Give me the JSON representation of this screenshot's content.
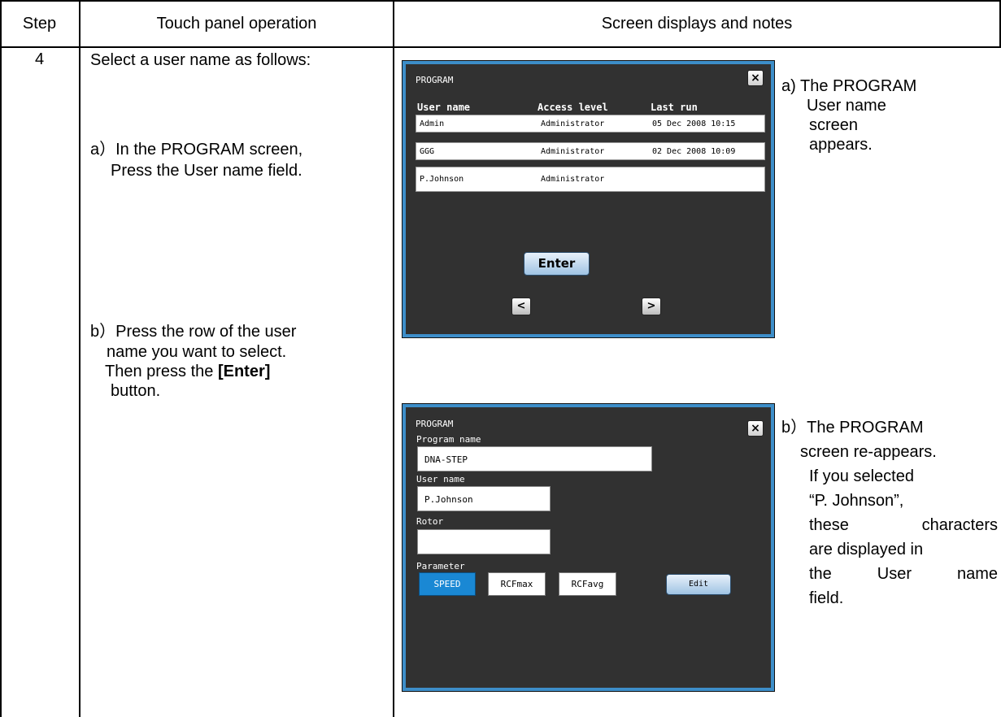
{
  "table": {
    "headers": {
      "step": "Step",
      "operation": "Touch panel operation",
      "displays": "Screen displays and notes"
    },
    "step_number": "4",
    "operation": {
      "intro": "Select a user name as follows:",
      "a_line1": "a）In the PROGRAM screen,",
      "a_line2": "Press the User name field.",
      "b_line1": "b）Press the row of the user",
      "b_line2": "name you want to select.",
      "b_line3_prefix": "Then press the ",
      "b_line3_bold": "[Enter]",
      "b_line4": "button."
    },
    "notes": {
      "a_line1": "a) The PROGRAM",
      "a_line2": "User name",
      "a_line3": "screen",
      "a_line4": "appears.",
      "b_line1": "b）The PROGRAM",
      "b_line2": "screen re-appears.",
      "b_line3": "If you selected",
      "b_line4": "“P. Johnson”,",
      "b_line5": "these characters",
      "b_line6": "are displayed in",
      "b_line7": "the User name",
      "b_line8": "field."
    }
  },
  "screen_a": {
    "title": "PROGRAM",
    "close": "×",
    "columns": [
      "User name",
      "Access level",
      "Last run"
    ],
    "rows": [
      {
        "name": "Admin",
        "level": "Administrator",
        "last_run": "05 Dec 2008 10:15"
      },
      {
        "name": "GGG",
        "level": "Administrator",
        "last_run": "02 Dec 2008 10:09"
      },
      {
        "name": "P.Johnson",
        "level": "Administrator",
        "last_run": ""
      }
    ],
    "enter_label": "Enter",
    "prev_label": "<",
    "next_label": ">"
  },
  "screen_b": {
    "title": "PROGRAM",
    "close": "×",
    "program_name_label": "Program name",
    "program_name_value": "DNA-STEP",
    "user_name_label": "User name",
    "user_name_value": "P.Johnson",
    "rotor_label": "Rotor",
    "rotor_value": "",
    "parameter_label": "Parameter",
    "parameters": [
      "SPEED",
      "RCFmax",
      "RCFavg"
    ],
    "selected_parameter": "SPEED",
    "edit_label": "Edit"
  },
  "colors": {
    "screen_bg": "#313131",
    "screen_border": "#3d8ec9",
    "selected_button": "#1a88d4"
  }
}
